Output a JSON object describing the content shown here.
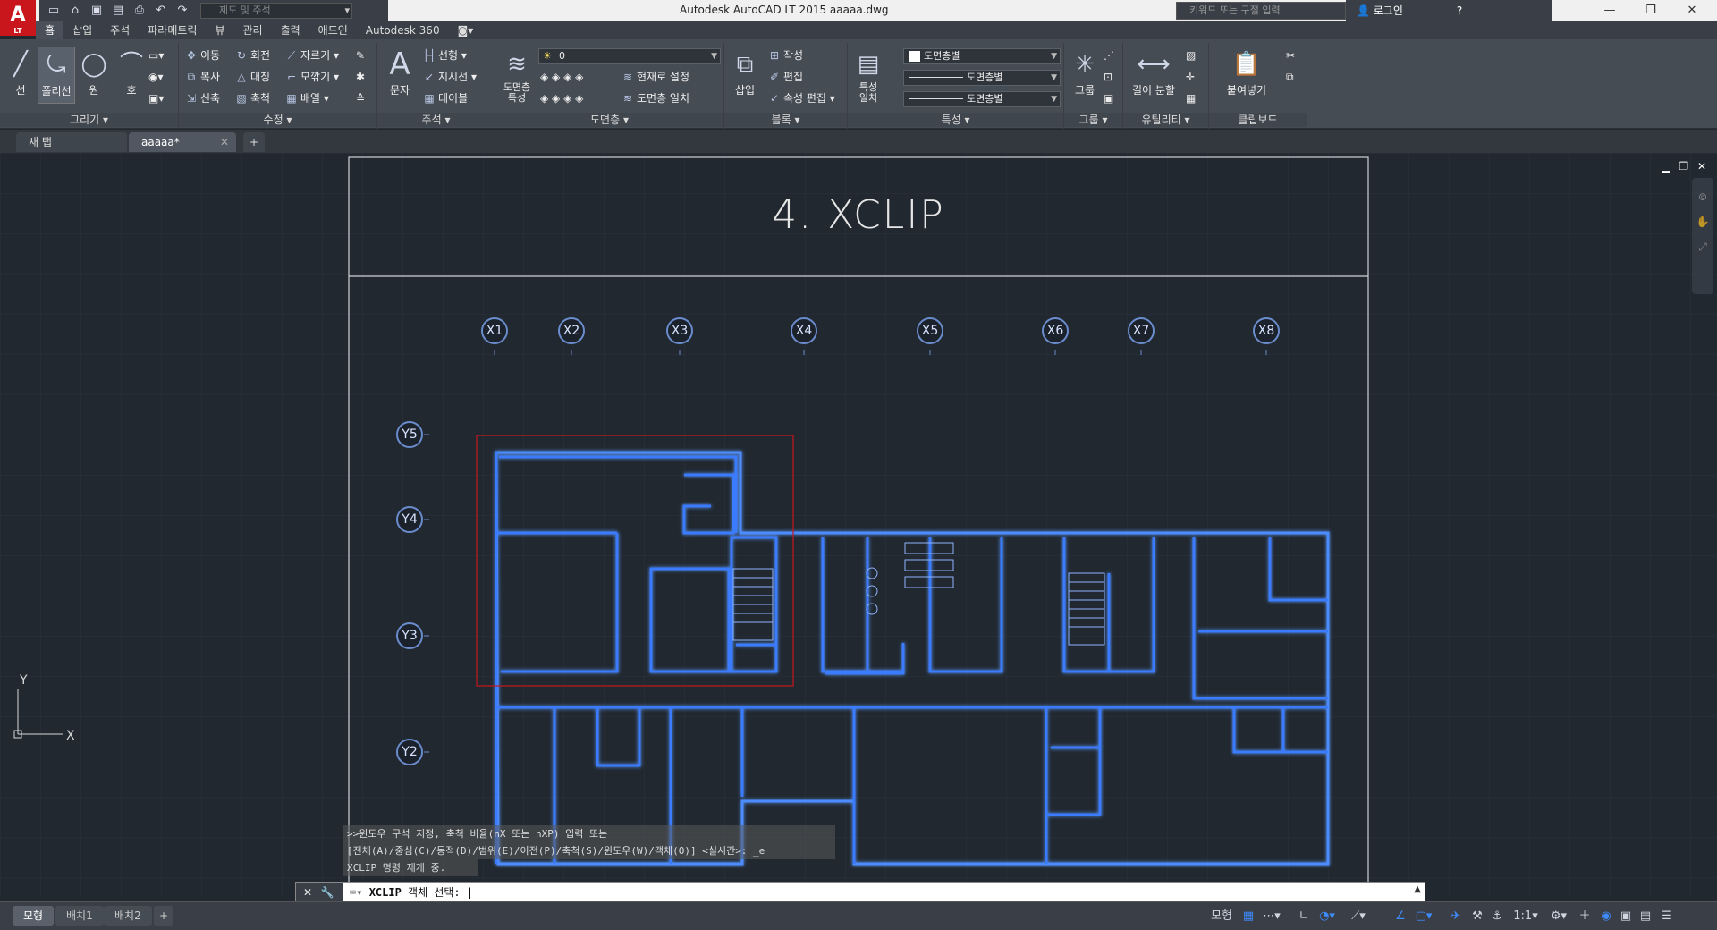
{
  "app": {
    "logo": "A",
    "logo_sub": "LT",
    "title": "Autodesk AutoCAD LT 2015     aaaaa.dwg",
    "workspace": "제도 및 주석",
    "search_placeholder": "키워드 또는 구절 입력",
    "login": "로그인"
  },
  "ribbon_tabs": [
    "홈",
    "삽입",
    "주석",
    "파라메트릭",
    "뷰",
    "관리",
    "출력",
    "애드인",
    "Autodesk 360"
  ],
  "ribbon": {
    "draw": {
      "label": "그리기",
      "line": "선",
      "polyline": "폴리선",
      "circle": "원",
      "arc": "호"
    },
    "modify": {
      "label": "수정",
      "move": "이동",
      "rotate": "회전",
      "trim": "자르기",
      "copy": "복사",
      "mirror": "대칭",
      "fillet": "모깎기",
      "stretch": "신축",
      "scale": "축척",
      "array": "배열"
    },
    "annotation": {
      "label": "주석",
      "text": "문자",
      "linear": "선형",
      "leader": "지시선",
      "table": "테이블"
    },
    "layers": {
      "label": "도면층",
      "properties": "도면층\n특성",
      "current_layer": "0",
      "make_current": "현재로 설정",
      "match": "도면층 일치"
    },
    "block": {
      "label": "블록",
      "insert": "삽입",
      "create": "작성",
      "edit": "편집",
      "attr_edit": "속성 편집"
    },
    "properties": {
      "label": "특성",
      "match": "특성\n일치",
      "color": "도면층별",
      "linetype": "도면층별",
      "lineweight": "도면층별"
    },
    "groups": {
      "label": "그룹",
      "group": "그룹"
    },
    "utilities": {
      "label": "유틸리티",
      "measure": "길이 분할"
    },
    "clipboard": {
      "label": "클립보드",
      "paste": "붙여넣기"
    }
  },
  "doc_tabs": [
    "새 탭",
    "aaaaa*"
  ],
  "drawing": {
    "title": "4. XCLIP",
    "x_grid": [
      "X1",
      "X2",
      "X3",
      "X4",
      "X5",
      "X6",
      "X7",
      "X8"
    ],
    "y_grid": [
      "Y5",
      "Y4",
      "Y3",
      "Y2"
    ],
    "ucs_x": "X",
    "ucs_y": "Y"
  },
  "command": {
    "history": [
      ">>윈도우 구석 지정, 축척 비율(nX 또는 nXP) 입력 또는",
      "[전체(A)/중심(C)/동적(D)/범위(E)/이전(P)/축척(S)/윈도우(W)/객체(O)] <실시간>: _e",
      "XCLIP 명령 재개 중."
    ],
    "prompt_cmd": "XCLIP",
    "prompt_text": " 객체 선택: |"
  },
  "layout_tabs": [
    "모형",
    "배치1",
    "배치2"
  ],
  "status": {
    "model": "모형",
    "scale": "1:1"
  }
}
